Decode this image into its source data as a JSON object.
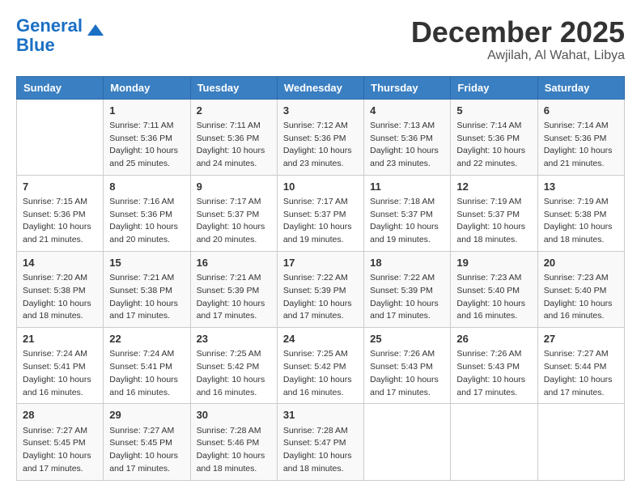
{
  "logo": {
    "line1": "General",
    "line2": "Blue"
  },
  "header": {
    "month": "December 2025",
    "location": "Awjilah, Al Wahat, Libya"
  },
  "weekdays": [
    "Sunday",
    "Monday",
    "Tuesday",
    "Wednesday",
    "Thursday",
    "Friday",
    "Saturday"
  ],
  "weeks": [
    [
      {
        "day": "",
        "sunrise": "",
        "sunset": "",
        "daylight": ""
      },
      {
        "day": "1",
        "sunrise": "Sunrise: 7:11 AM",
        "sunset": "Sunset: 5:36 PM",
        "daylight": "Daylight: 10 hours and 25 minutes."
      },
      {
        "day": "2",
        "sunrise": "Sunrise: 7:11 AM",
        "sunset": "Sunset: 5:36 PM",
        "daylight": "Daylight: 10 hours and 24 minutes."
      },
      {
        "day": "3",
        "sunrise": "Sunrise: 7:12 AM",
        "sunset": "Sunset: 5:36 PM",
        "daylight": "Daylight: 10 hours and 23 minutes."
      },
      {
        "day": "4",
        "sunrise": "Sunrise: 7:13 AM",
        "sunset": "Sunset: 5:36 PM",
        "daylight": "Daylight: 10 hours and 23 minutes."
      },
      {
        "day": "5",
        "sunrise": "Sunrise: 7:14 AM",
        "sunset": "Sunset: 5:36 PM",
        "daylight": "Daylight: 10 hours and 22 minutes."
      },
      {
        "day": "6",
        "sunrise": "Sunrise: 7:14 AM",
        "sunset": "Sunset: 5:36 PM",
        "daylight": "Daylight: 10 hours and 21 minutes."
      }
    ],
    [
      {
        "day": "7",
        "sunrise": "Sunrise: 7:15 AM",
        "sunset": "Sunset: 5:36 PM",
        "daylight": "Daylight: 10 hours and 21 minutes."
      },
      {
        "day": "8",
        "sunrise": "Sunrise: 7:16 AM",
        "sunset": "Sunset: 5:36 PM",
        "daylight": "Daylight: 10 hours and 20 minutes."
      },
      {
        "day": "9",
        "sunrise": "Sunrise: 7:17 AM",
        "sunset": "Sunset: 5:37 PM",
        "daylight": "Daylight: 10 hours and 20 minutes."
      },
      {
        "day": "10",
        "sunrise": "Sunrise: 7:17 AM",
        "sunset": "Sunset: 5:37 PM",
        "daylight": "Daylight: 10 hours and 19 minutes."
      },
      {
        "day": "11",
        "sunrise": "Sunrise: 7:18 AM",
        "sunset": "Sunset: 5:37 PM",
        "daylight": "Daylight: 10 hours and 19 minutes."
      },
      {
        "day": "12",
        "sunrise": "Sunrise: 7:19 AM",
        "sunset": "Sunset: 5:37 PM",
        "daylight": "Daylight: 10 hours and 18 minutes."
      },
      {
        "day": "13",
        "sunrise": "Sunrise: 7:19 AM",
        "sunset": "Sunset: 5:38 PM",
        "daylight": "Daylight: 10 hours and 18 minutes."
      }
    ],
    [
      {
        "day": "14",
        "sunrise": "Sunrise: 7:20 AM",
        "sunset": "Sunset: 5:38 PM",
        "daylight": "Daylight: 10 hours and 18 minutes."
      },
      {
        "day": "15",
        "sunrise": "Sunrise: 7:21 AM",
        "sunset": "Sunset: 5:38 PM",
        "daylight": "Daylight: 10 hours and 17 minutes."
      },
      {
        "day": "16",
        "sunrise": "Sunrise: 7:21 AM",
        "sunset": "Sunset: 5:39 PM",
        "daylight": "Daylight: 10 hours and 17 minutes."
      },
      {
        "day": "17",
        "sunrise": "Sunrise: 7:22 AM",
        "sunset": "Sunset: 5:39 PM",
        "daylight": "Daylight: 10 hours and 17 minutes."
      },
      {
        "day": "18",
        "sunrise": "Sunrise: 7:22 AM",
        "sunset": "Sunset: 5:39 PM",
        "daylight": "Daylight: 10 hours and 17 minutes."
      },
      {
        "day": "19",
        "sunrise": "Sunrise: 7:23 AM",
        "sunset": "Sunset: 5:40 PM",
        "daylight": "Daylight: 10 hours and 16 minutes."
      },
      {
        "day": "20",
        "sunrise": "Sunrise: 7:23 AM",
        "sunset": "Sunset: 5:40 PM",
        "daylight": "Daylight: 10 hours and 16 minutes."
      }
    ],
    [
      {
        "day": "21",
        "sunrise": "Sunrise: 7:24 AM",
        "sunset": "Sunset: 5:41 PM",
        "daylight": "Daylight: 10 hours and 16 minutes."
      },
      {
        "day": "22",
        "sunrise": "Sunrise: 7:24 AM",
        "sunset": "Sunset: 5:41 PM",
        "daylight": "Daylight: 10 hours and 16 minutes."
      },
      {
        "day": "23",
        "sunrise": "Sunrise: 7:25 AM",
        "sunset": "Sunset: 5:42 PM",
        "daylight": "Daylight: 10 hours and 16 minutes."
      },
      {
        "day": "24",
        "sunrise": "Sunrise: 7:25 AM",
        "sunset": "Sunset: 5:42 PM",
        "daylight": "Daylight: 10 hours and 16 minutes."
      },
      {
        "day": "25",
        "sunrise": "Sunrise: 7:26 AM",
        "sunset": "Sunset: 5:43 PM",
        "daylight": "Daylight: 10 hours and 17 minutes."
      },
      {
        "day": "26",
        "sunrise": "Sunrise: 7:26 AM",
        "sunset": "Sunset: 5:43 PM",
        "daylight": "Daylight: 10 hours and 17 minutes."
      },
      {
        "day": "27",
        "sunrise": "Sunrise: 7:27 AM",
        "sunset": "Sunset: 5:44 PM",
        "daylight": "Daylight: 10 hours and 17 minutes."
      }
    ],
    [
      {
        "day": "28",
        "sunrise": "Sunrise: 7:27 AM",
        "sunset": "Sunset: 5:45 PM",
        "daylight": "Daylight: 10 hours and 17 minutes."
      },
      {
        "day": "29",
        "sunrise": "Sunrise: 7:27 AM",
        "sunset": "Sunset: 5:45 PM",
        "daylight": "Daylight: 10 hours and 17 minutes."
      },
      {
        "day": "30",
        "sunrise": "Sunrise: 7:28 AM",
        "sunset": "Sunset: 5:46 PM",
        "daylight": "Daylight: 10 hours and 18 minutes."
      },
      {
        "day": "31",
        "sunrise": "Sunrise: 7:28 AM",
        "sunset": "Sunset: 5:47 PM",
        "daylight": "Daylight: 10 hours and 18 minutes."
      },
      {
        "day": "",
        "sunrise": "",
        "sunset": "",
        "daylight": ""
      },
      {
        "day": "",
        "sunrise": "",
        "sunset": "",
        "daylight": ""
      },
      {
        "day": "",
        "sunrise": "",
        "sunset": "",
        "daylight": ""
      }
    ]
  ]
}
